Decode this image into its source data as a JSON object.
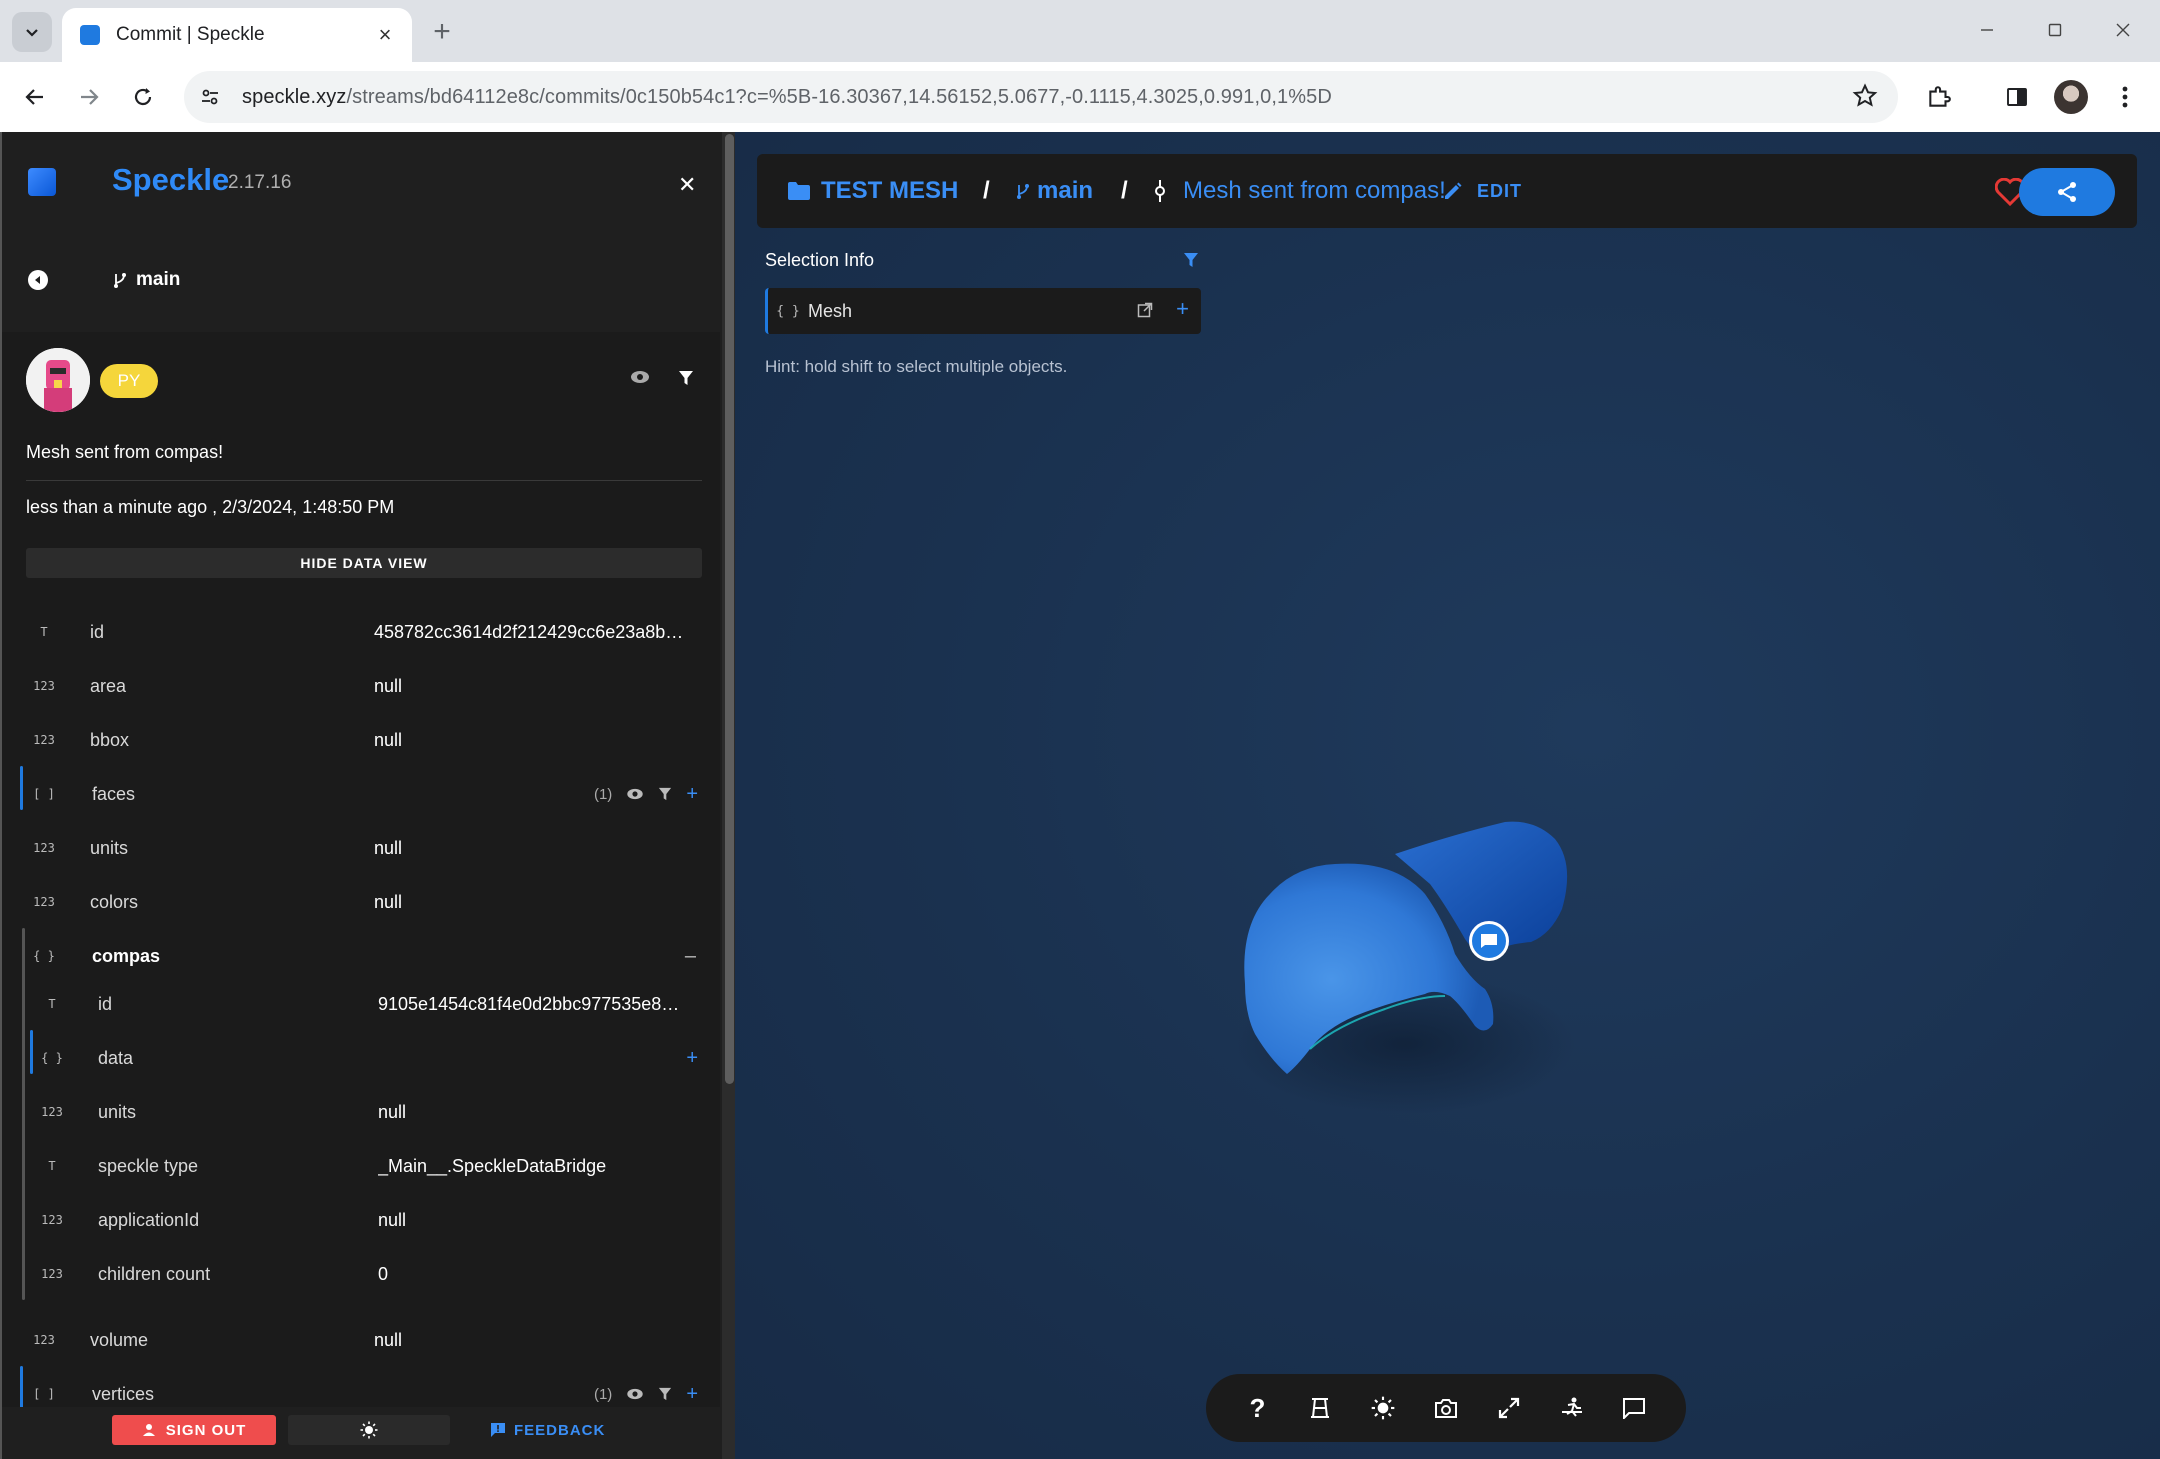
{
  "browser": {
    "tab_title": "Commit | Speckle",
    "url_host": "speckle.xyz",
    "url_path": "/streams/bd64112e8c/commits/0c150b54c1?c=%5B-16.30367,14.56152,5.0677,-0.1115,4.3025,0.991,0,1%5D"
  },
  "sidebar": {
    "brand": "Speckle",
    "version": "2.17.16",
    "branch": "main",
    "commit": {
      "author_chip": "PY",
      "message": "Mesh sent from compas!",
      "date": "less than a minute ago , 2/3/2024, 1:48:50 PM",
      "hide_data_label": "HIDE DATA VIEW"
    },
    "fields": [
      {
        "type": "T",
        "key": "id",
        "value": "458782cc3614d2f212429cc6e23a8b…"
      },
      {
        "type": "123",
        "key": "area",
        "value": "null"
      },
      {
        "type": "123",
        "key": "bbox",
        "value": "null"
      },
      {
        "type": "[ ]",
        "key": "faces",
        "value": "",
        "count": "(1)"
      },
      {
        "type": "123",
        "key": "units",
        "value": "null"
      },
      {
        "type": "123",
        "key": "colors",
        "value": "null"
      },
      {
        "type": "{ }",
        "key": "compas",
        "value": ""
      },
      {
        "type": "T",
        "key": "id",
        "value": "9105e1454c81f4e0d2bbc977535e8…"
      },
      {
        "type": "{ }",
        "key": "data",
        "value": ""
      },
      {
        "type": "123",
        "key": "units",
        "value": "null"
      },
      {
        "type": "T",
        "key": "speckle type",
        "value": "_Main__.SpeckleDataBridge"
      },
      {
        "type": "123",
        "key": "applicationId",
        "value": "null"
      },
      {
        "type": "123",
        "key": "children count",
        "value": "0"
      },
      {
        "type": "123",
        "key": "volume",
        "value": "null"
      },
      {
        "type": "[ ]",
        "key": "vertices",
        "value": "",
        "count": "(1)"
      }
    ],
    "footer": {
      "signout": "SIGN OUT",
      "feedback": "FEEDBACK"
    }
  },
  "viewer": {
    "stream": "TEST MESH",
    "branch": "main",
    "commit": "Mesh sent from compas!",
    "edit": "EDIT",
    "selection_title": "Selection Info",
    "selection_item": "Mesh",
    "selection_item_type": "{ }",
    "hint": "Hint: hold shift to select multiple objects."
  }
}
